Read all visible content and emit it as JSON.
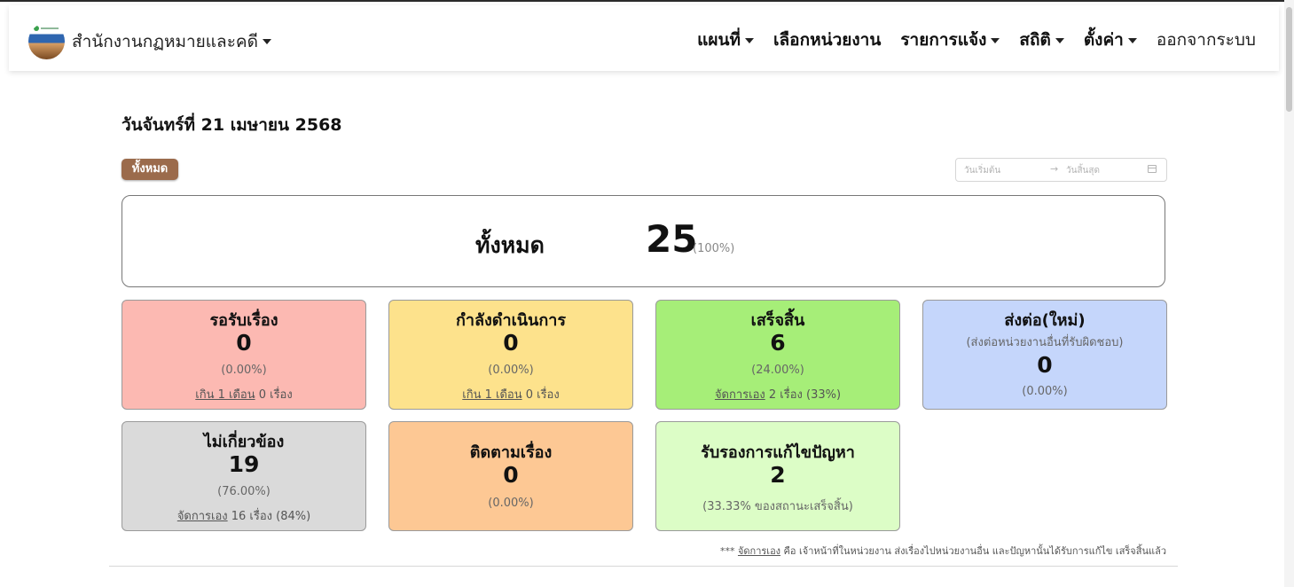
{
  "header": {
    "org_name": "สำนักงานกฏหมายและคดี",
    "nav": {
      "map": "แผนที่",
      "select_unit": "เลือกหน่วยงาน",
      "reports": "รายการแจ้ง",
      "stats": "สถิติ",
      "settings": "ตั้งค่า",
      "logout": "ออกจากระบบ"
    }
  },
  "page": {
    "date_title": "วันจันทร์ที่ 21 เมษายน 2568",
    "filter_all": "ทั้งหมด",
    "date_range": {
      "start_placeholder": "วันเริ่มต้น",
      "arrow": "→",
      "end_placeholder": "วันสิ้นสุด"
    }
  },
  "total": {
    "label": "ทั้งหมด",
    "value": "25",
    "percent": "(100%)"
  },
  "cards": {
    "pending": {
      "title": "รอรับเรื่อง",
      "value": "0",
      "percent": "(0.00%)",
      "note_link": "เกิน 1 เดือน",
      "note_text": " 0 เรื่อง",
      "color": "#fcb9b2"
    },
    "in_progress": {
      "title": "กำลังดำเนินการ",
      "value": "0",
      "percent": "(0.00%)",
      "note_link": "เกิน 1 เดือน",
      "note_text": " 0 เรื่อง",
      "color": "#fde28c"
    },
    "done": {
      "title": "เสร็จสิ้น",
      "value": "6",
      "percent": "(24.00%)",
      "note_link": "จัดการเอง",
      "note_text": " 2 เรื่อง (33%)",
      "color": "#a6ee78"
    },
    "forwarded": {
      "title": "ส่งต่อ(ใหม่)",
      "subtitle": "(ส่งต่อหน่วยงานอื่นที่รับผิดชอบ)",
      "value": "0",
      "percent": "(0.00%)",
      "color": "#c5d6fb"
    },
    "irrelevant": {
      "title": "ไม่เกี่ยวข้อง",
      "value": "19",
      "percent": "(76.00%)",
      "note_link": "จัดการเอง",
      "note_text": " 16 เรื่อง (84%)",
      "color": "#dadada"
    },
    "follow_up": {
      "title": "ติดตามเรื่อง",
      "value": "0",
      "percent": "(0.00%)",
      "color": "#fdc894"
    },
    "certified": {
      "title": "รับรองการแก้ไขปัญหา",
      "value": "2",
      "percent": "(33.33% ของสถานะเสร็จสิ้น)",
      "color": "#dcfdc6"
    }
  },
  "footnote": {
    "prefix": "*** ",
    "link": "จัดการเอง",
    "text": " คือ เจ้าหน้าที่ในหน่วยงาน ส่งเรื่องไปหน่วยงานอื่น และปัญหานั้นได้รับการแก้ไข เสร็จสิ้นแล้ว"
  }
}
